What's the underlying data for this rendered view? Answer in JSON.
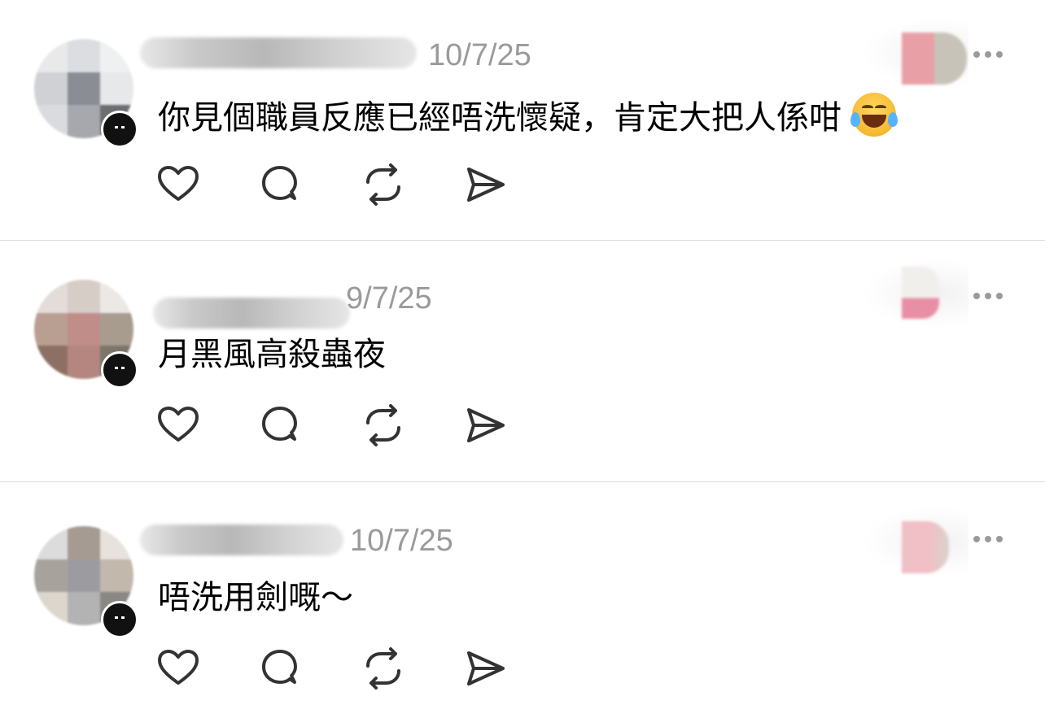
{
  "comments": [
    {
      "timestamp": "10/7/25",
      "text": "你見個職員反應已經唔洗懷疑，肯定大把人係咁",
      "emoji": "face-with-tears-of-joy"
    },
    {
      "timestamp": "9/7/25",
      "text": "月黑風高殺蟲夜"
    },
    {
      "timestamp": "10/7/25",
      "text": "唔洗用劍嘅～"
    }
  ],
  "icons": {
    "like": "heart-icon",
    "reply": "comment-bubble-icon",
    "repost": "repost-icon",
    "share": "send-icon",
    "more": "more-icon"
  },
  "colors": {
    "text": "#000000",
    "timestamp": "#9a9a9a",
    "icon": "#333333",
    "divider": "#dcdcdc"
  }
}
